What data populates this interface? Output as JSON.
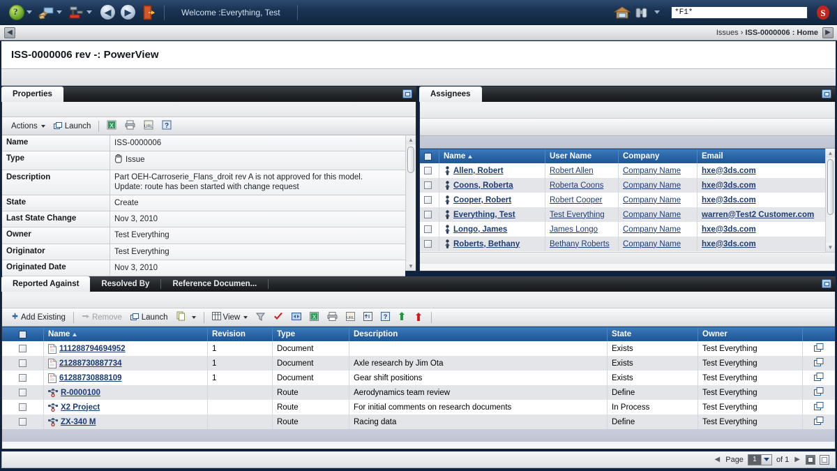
{
  "topbar": {
    "items": [
      {
        "name": "help-globe-icon",
        "label": "",
        "caret": true
      },
      {
        "name": "collaboration-icon",
        "label": "",
        "caret": true
      },
      {
        "name": "tools-icon",
        "label": "",
        "caret": true
      },
      {
        "name": "back-arrow-icon",
        "label": "",
        "caret": false
      },
      {
        "name": "forward-arrow-icon",
        "label": "",
        "caret": false
      },
      {
        "name": "exit-door-icon",
        "label": "",
        "caret": false
      }
    ],
    "welcome": "Welcome :Everything, Test",
    "home_icon": "home-icon",
    "search_icon": "binoculars-icon",
    "search_value": "*F1*",
    "search_placeholder": "",
    "brand_icon": "s-logo-icon"
  },
  "breadcrumb": {
    "back_glyph": "◀",
    "forward_glyph": "▶",
    "prefix": "Issues › ",
    "current": "ISS-0000006 : Home"
  },
  "page": {
    "title": "ISS-0000006 rev -: PowerView"
  },
  "properties_panel": {
    "tab_label": "Properties",
    "maximize_icon": "maximize-icon",
    "toolbar": {
      "actions_label": "Actions",
      "launch_label": "Launch",
      "icons": [
        {
          "name": "excel-export-icon"
        },
        {
          "name": "print-icon"
        },
        {
          "name": "url-icon"
        },
        {
          "name": "help-icon"
        }
      ]
    },
    "rows": [
      {
        "key": "Name",
        "value": "ISS-0000006",
        "icon": null
      },
      {
        "key": "Type",
        "value": "Issue",
        "icon": "hand-cursor-icon"
      },
      {
        "key": "Description",
        "value": "Part OEH-Carroserie_Flans_droit rev A is not approved for this model.\nUpdate: route has been started with change request",
        "icon": null
      },
      {
        "key": "State",
        "value": "Create",
        "icon": null
      },
      {
        "key": "Last State Change",
        "value": "Nov 3, 2010",
        "icon": null
      },
      {
        "key": "Owner",
        "value": "Test Everything",
        "icon": null
      },
      {
        "key": "Originator",
        "value": "Test Everything",
        "icon": null
      },
      {
        "key": "Originated Date",
        "value": "Nov 3, 2010",
        "icon": null
      }
    ]
  },
  "assignees_panel": {
    "tab_label": "Assignees",
    "maximize_icon": "maximize-icon",
    "columns": [
      "Name",
      "User Name",
      "Company",
      "Email"
    ],
    "sort_column": "Name",
    "sort_dir": "asc",
    "rows": [
      {
        "name": "Allen, Robert",
        "user_name": "Robert Allen",
        "company": "Company Name",
        "email": "hxe@3ds.com"
      },
      {
        "name": "Coons, Roberta",
        "user_name": "Roberta Coons",
        "company": "Company Name",
        "email": "hxe@3ds.com"
      },
      {
        "name": "Cooper, Robert",
        "user_name": "Robert Cooper",
        "company": "Company Name",
        "email": "hxe@3ds.com"
      },
      {
        "name": "Everything, Test",
        "user_name": "Test Everything",
        "company": "Company Name",
        "email": "warren@Test2 Customer.com"
      },
      {
        "name": "Longo, James",
        "user_name": "James Longo",
        "company": "Company Name",
        "email": "hxe@3ds.com"
      },
      {
        "name": "Roberts, Bethany",
        "user_name": "Bethany Roberts",
        "company": "Company Name",
        "email": "hxe@3ds.com"
      }
    ]
  },
  "bottom_panel": {
    "tabs": [
      {
        "label": "Reported Against",
        "active": true
      },
      {
        "label": "Resolved By",
        "active": false
      },
      {
        "label": "Reference Documen...",
        "active": false
      }
    ],
    "maximize_icon": "maximize-icon",
    "toolbar": {
      "add_existing_label": "Add Existing",
      "remove_label": "Remove",
      "launch_label": "Launch",
      "view_label": "View",
      "icons": [
        {
          "name": "copy-icon"
        },
        {
          "name": "filter-icon"
        },
        {
          "name": "checkmark-icon"
        },
        {
          "name": "compare-icon"
        },
        {
          "name": "excel-export-icon"
        },
        {
          "name": "print-icon"
        },
        {
          "name": "url-icon"
        },
        {
          "name": "expand-icon"
        },
        {
          "name": "help-icon"
        },
        {
          "name": "green-arrow-icon"
        },
        {
          "name": "red-arrow-icon"
        }
      ]
    },
    "columns": [
      "Name",
      "Revision",
      "Type",
      "Description",
      "State",
      "Owner"
    ],
    "sort_column": "Name",
    "sort_dir": "asc",
    "rows": [
      {
        "name": "111288794694952",
        "icon": "document-icon",
        "revision": "1",
        "type": "Document",
        "description": "",
        "state": "Exists",
        "owner": "Test Everything"
      },
      {
        "name": "21288730887734",
        "icon": "document-icon",
        "revision": "1",
        "type": "Document",
        "description": "Axle research by Jim Ota",
        "state": "Exists",
        "owner": "Test Everything"
      },
      {
        "name": "61288730888109",
        "icon": "document-icon",
        "revision": "1",
        "type": "Document",
        "description": "Gear shift positions",
        "state": "Exists",
        "owner": "Test Everything"
      },
      {
        "name": "R-0000100",
        "icon": "route-icon",
        "revision": "",
        "type": "Route",
        "description": "Aerodynamics team review",
        "state": "Define",
        "owner": "Test Everything"
      },
      {
        "name": "X2 Project",
        "icon": "route-icon",
        "revision": "",
        "type": "Route",
        "description": "For initial comments on research documents",
        "state": "In Process",
        "owner": "Test Everything"
      },
      {
        "name": "ZX-340 M",
        "icon": "route-icon",
        "revision": "",
        "type": "Route",
        "description": "Racing data",
        "state": "Define",
        "owner": "Test Everything"
      }
    ],
    "pagination": {
      "prev_glyph": "◀",
      "next_glyph": "▶",
      "page_label": "Page",
      "page_value": "1",
      "of_label": "of 1"
    }
  },
  "colors": {
    "header_blue": "#1b3455",
    "grid_header_blue": "#2c68aa",
    "link_blue": "#1b3c74",
    "panel_bg": "#f5f6f7",
    "app_border": "#0d2240"
  }
}
